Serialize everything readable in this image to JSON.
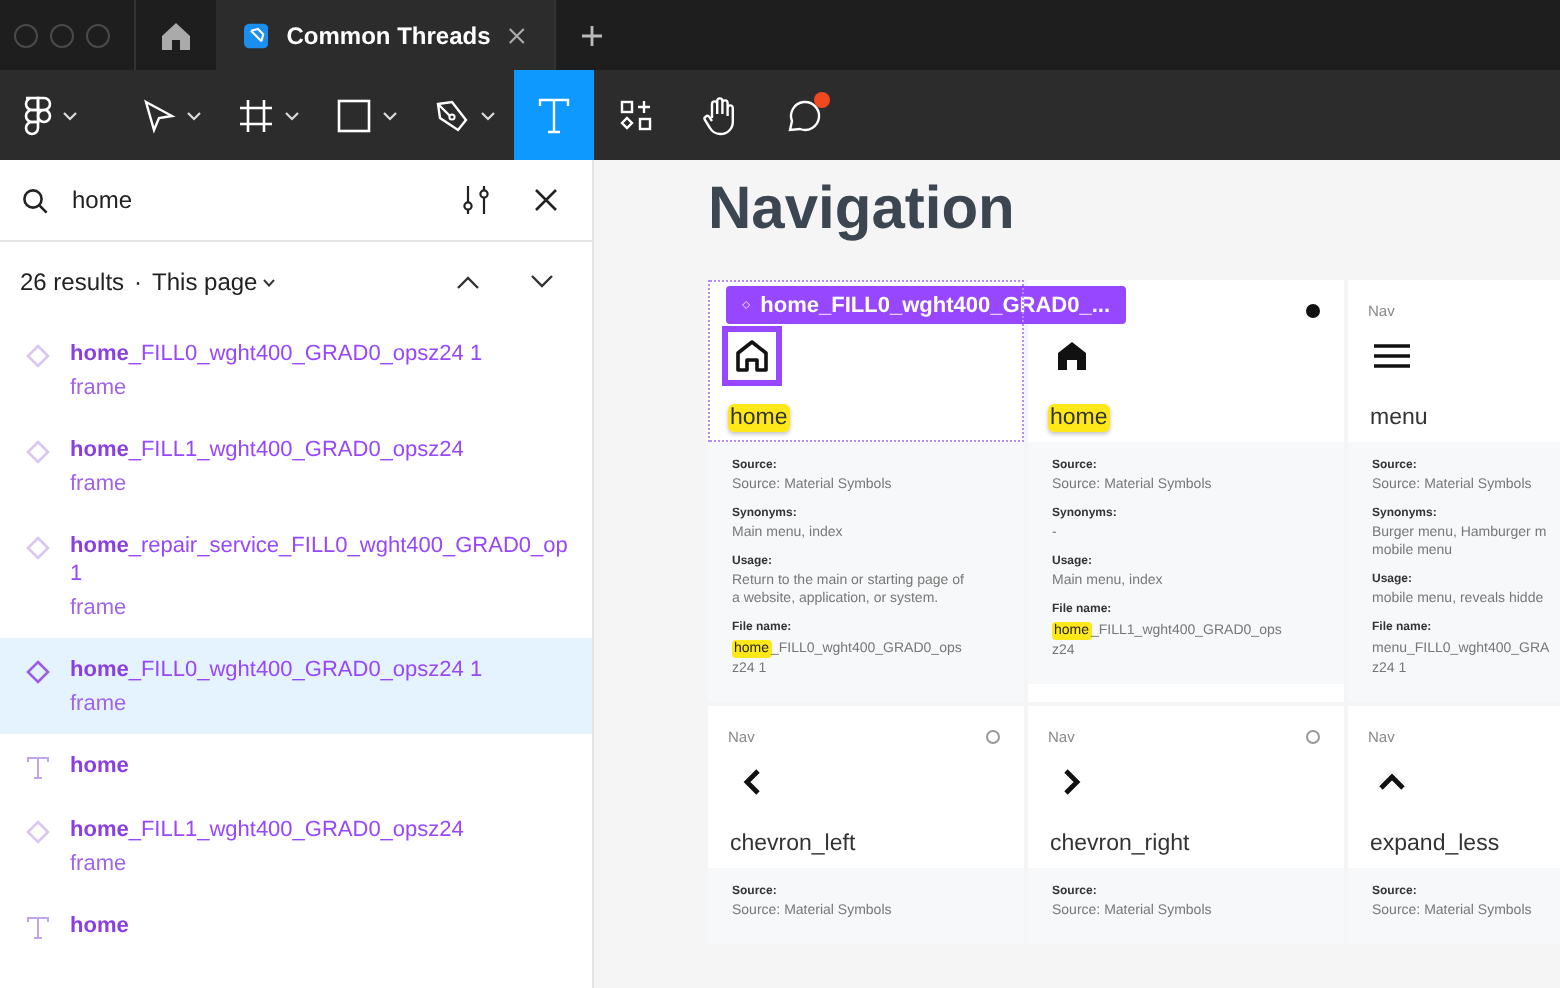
{
  "titlebar": {
    "tabs": [
      {
        "kind": "home",
        "selected": false
      },
      {
        "kind": "document",
        "title": "Common Threads",
        "selected": true
      }
    ]
  },
  "toolbar": {
    "tools": [
      {
        "kind": "main-menu",
        "menu": true,
        "selected": false
      },
      {
        "kind": "move",
        "menu": true,
        "selected": false
      },
      {
        "kind": "frame",
        "menu": true,
        "selected": false
      },
      {
        "kind": "rectangle",
        "menu": true,
        "selected": false
      },
      {
        "kind": "pen",
        "menu": true,
        "selected": false
      },
      {
        "kind": "text",
        "menu": false,
        "selected": true
      },
      {
        "kind": "resources",
        "menu": false,
        "selected": false
      },
      {
        "kind": "hand",
        "menu": false,
        "selected": false
      },
      {
        "kind": "comment",
        "menu": false,
        "selected": false,
        "notification": true
      }
    ]
  },
  "search": {
    "value": "home",
    "count": "26 results",
    "separator": "·",
    "scope": "This page"
  },
  "results": [
    {
      "kind": "frame",
      "title": "**home**_FILL0_wght400_GRAD0_opsz24 1",
      "subtitle": "frame",
      "selected": false
    },
    {
      "kind": "frame",
      "title": "**home**_FILL1_wght400_GRAD0_opsz24",
      "subtitle": "frame",
      "selected": false
    },
    {
      "kind": "frame",
      "title": "**home**_repair_service_FILL0_wght400_GRAD0_op 1",
      "subtitle": "frame",
      "selected": false
    },
    {
      "kind": "frame",
      "title": "**home**_FILL0_wght400_GRAD0_opsz24 1",
      "subtitle": "frame",
      "selected": true
    },
    {
      "kind": "text",
      "title": "**home**",
      "selected": false
    },
    {
      "kind": "frame",
      "title": "**home**_FILL1_wght400_GRAD0_opsz24",
      "subtitle": "frame",
      "selected": false
    },
    {
      "kind": "text",
      "title": "**home**",
      "selected": false
    }
  ],
  "canvas": {
    "heading": "Navigation",
    "selection_label": "home_FILL0_wght400_GRAD0_...",
    "cards": [
      {
        "kind": "home-outline",
        "name": "home",
        "name_match": true,
        "selected": true,
        "details": [
          {
            "kind": "text",
            "label": "Source:",
            "lines": [
              "Source: Material Symbols"
            ]
          },
          {
            "kind": "text",
            "label": "Synonyms:",
            "lines": [
              "Main menu, index"
            ]
          },
          {
            "kind": "text",
            "label": "Usage:",
            "lines": [
              "Return to the main or starting page of",
              "a website, application, or system."
            ]
          },
          {
            "kind": "file",
            "label": "File name:",
            "match": "home",
            "lines": [
              "_FILL0_wght400_GRAD0_ops",
              "z24 1"
            ]
          }
        ]
      },
      {
        "kind": "home-filled",
        "name": "home",
        "name_match": true,
        "selected": false,
        "done": true,
        "details": [
          {
            "kind": "text",
            "label": "Source:",
            "lines": [
              "Source: Material Symbols"
            ]
          },
          {
            "kind": "text",
            "label": "Synonyms:",
            "lines": [
              "-"
            ]
          },
          {
            "kind": "text",
            "label": "Usage:",
            "lines": [
              "Main menu, index"
            ]
          },
          {
            "kind": "file",
            "label": "File name:",
            "match": "home",
            "lines": [
              "_FILL1_wght400_GRAD0_ops",
              "z24"
            ]
          }
        ]
      },
      {
        "category": "Nav",
        "kind": "menu",
        "name": "menu",
        "name_match": false,
        "selected": false,
        "details": [
          {
            "kind": "text",
            "label": "Source:",
            "lines": [
              "Source: Material Symbols"
            ]
          },
          {
            "kind": "text",
            "label": "Synonyms:",
            "lines": [
              "Burger menu, Hamburger m",
              "mobile menu"
            ]
          },
          {
            "kind": "text",
            "label": "Usage:",
            "lines": [
              "mobile menu, reveals hidde"
            ]
          },
          {
            "kind": "file",
            "label": "File name:",
            "lines": [
              "menu_FILL0_wght400_GRA",
              "z24 1"
            ]
          }
        ]
      },
      {
        "category": "Nav",
        "kind": "chevron-left",
        "name": "chevron_left",
        "name_match": false,
        "selected": false,
        "done": false,
        "details": [
          {
            "kind": "text",
            "label": "Source:",
            "lines": [
              "Source: Material Symbols"
            ]
          }
        ]
      },
      {
        "category": "Nav",
        "kind": "chevron-right",
        "name": "chevron_right",
        "name_match": false,
        "selected": false,
        "done": false,
        "details": [
          {
            "kind": "text",
            "label": "Source:",
            "lines": [
              "Source: Material Symbols"
            ]
          }
        ]
      },
      {
        "category": "Nav",
        "kind": "expand-less",
        "name": "expand_less",
        "name_match": false,
        "selected": false,
        "details": [
          {
            "kind": "text",
            "label": "Source:",
            "lines": [
              "Source: Material Symbols"
            ]
          }
        ]
      }
    ]
  }
}
